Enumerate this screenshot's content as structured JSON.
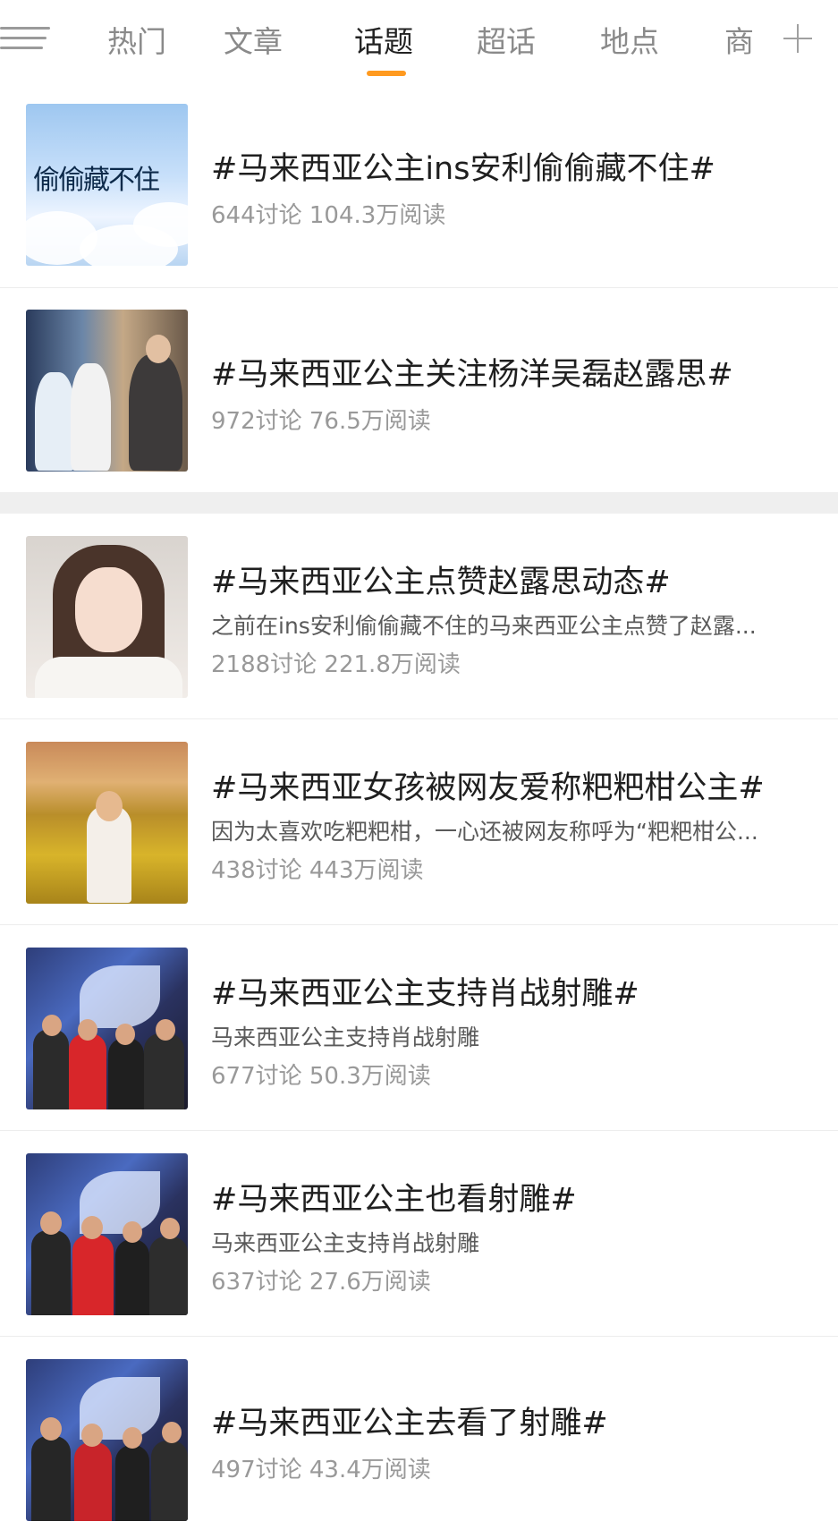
{
  "tabs": [
    {
      "label": "热门",
      "active": false
    },
    {
      "label": "文章",
      "active": false
    },
    {
      "label": "话题",
      "active": true
    },
    {
      "label": "超话",
      "active": false
    },
    {
      "label": "地点",
      "active": false
    },
    {
      "label": "商",
      "active": false
    }
  ],
  "icons": {
    "menu": "menu-icon",
    "add": "plus-icon"
  },
  "accent_color": "#ff9a1f",
  "topics": [
    {
      "title": "#马来西亚公主ins安利偷偷藏不住#",
      "desc": "",
      "stats": "644讨论 104.3万阅读",
      "thumb_text": "偷偷藏不住"
    },
    {
      "title": "#马来西亚公主关注杨洋吴磊赵露思#",
      "desc": "",
      "stats": "972讨论 76.5万阅读"
    },
    {
      "title": "#马来西亚公主点赞赵露思动态#",
      "desc": "之前在ins安利偷偷藏不住的马来西亚公主点赞了赵露...",
      "stats": "2188讨论 221.8万阅读"
    },
    {
      "title": "#马来西亚女孩被网友爱称粑粑柑公主#",
      "desc": "因为太喜欢吃粑粑柑，一心还被网友称呼为“粑粑柑公...",
      "stats": "438讨论 443万阅读"
    },
    {
      "title": "#马来西亚公主支持肖战射雕#",
      "desc": "马来西亚公主支持肖战射雕",
      "stats": "677讨论 50.3万阅读"
    },
    {
      "title": "#马来西亚公主也看射雕#",
      "desc": "马来西亚公主支持肖战射雕",
      "stats": "637讨论 27.6万阅读"
    },
    {
      "title": "#马来西亚公主去看了射雕#",
      "desc": "",
      "stats": "497讨论 43.4万阅读"
    }
  ]
}
